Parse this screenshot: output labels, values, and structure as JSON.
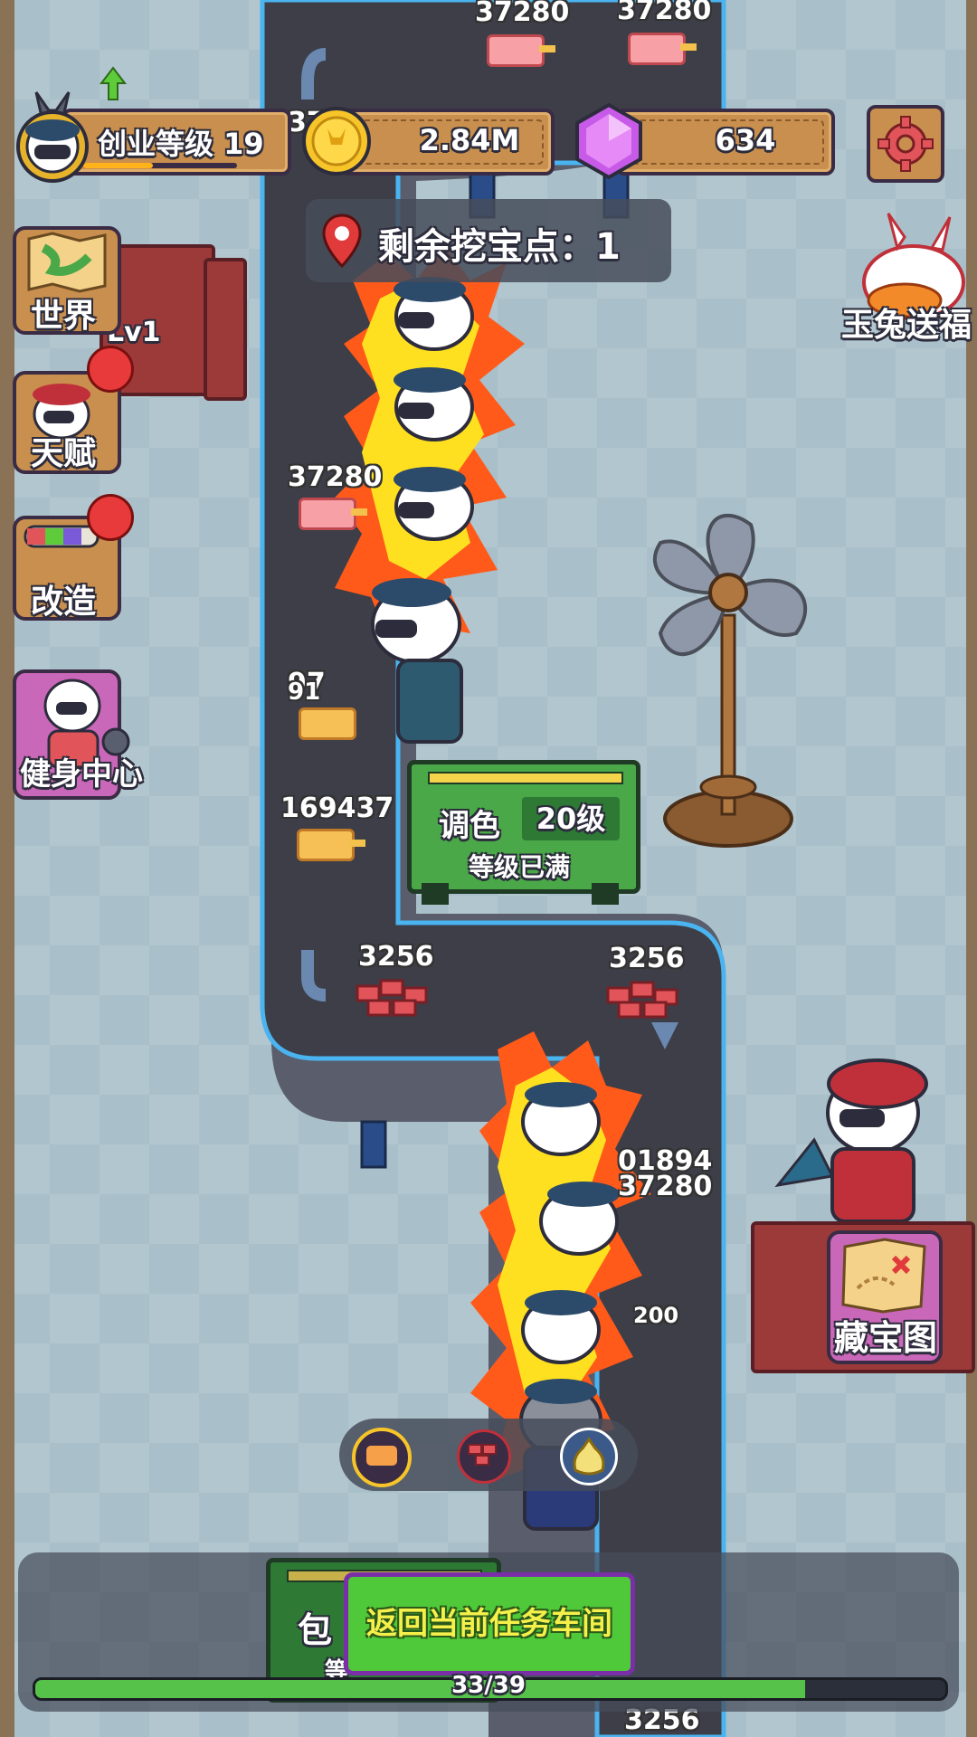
{
  "hud": {
    "level_label": "创业等级 19",
    "coins": "2.84M",
    "gems": "634"
  },
  "digging": {
    "label": "剩余挖宝点：1"
  },
  "side_menu": {
    "world": "世界",
    "talent": "天赋",
    "modify": "改造",
    "gym": "健身中心"
  },
  "right_menu": {
    "jade_rabbit": "玉兔送福",
    "treasure_map": "藏宝图"
  },
  "machine": {
    "name": "调色",
    "level": "20级",
    "status": "等级已满"
  },
  "station_level": "Lv1",
  "lower_machine": {
    "label_1": "包",
    "label_2": "等"
  },
  "floating_numbers": {
    "n1": "37280",
    "n2": "37280",
    "n3": "37280",
    "n4": "37280",
    "n5": "97",
    "n6": "91",
    "n7": "169437",
    "n8": "3256",
    "n9": "3256",
    "n10": "01894",
    "n11": "37280",
    "n12": "3256",
    "n13": "37",
    "n14": "200"
  },
  "bottom": {
    "return_button": "返回当前任务车间",
    "progress_text": "33/39",
    "progress_value": 0.846
  },
  "colors": {
    "road": "#3d3e48",
    "road_edge": "#4ab4f0",
    "button_green": "#4fc83a",
    "button_text": "#f6f04a",
    "progress": "#56c24a"
  }
}
